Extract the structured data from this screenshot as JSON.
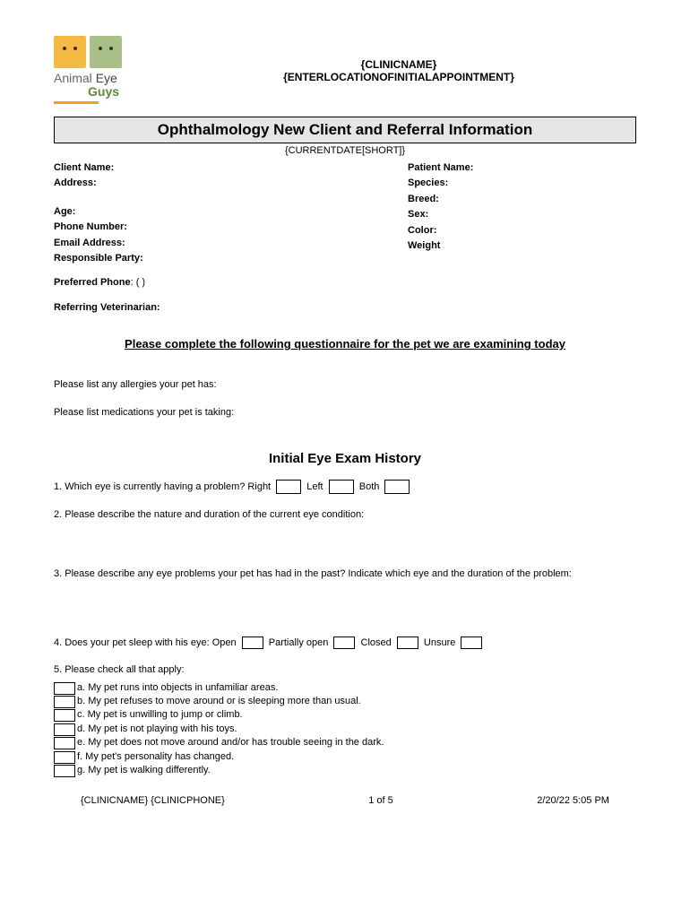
{
  "header": {
    "clinic_name_placeholder": "{CLINICNAME}",
    "location_placeholder": "{ENTERLOCATIONOFINITIALAPPOINTMENT}",
    "logo_text_1": "Animal",
    "logo_text_2": "Eye",
    "logo_text_3": "Guys"
  },
  "title": "Ophthalmology New Client and Referral Information",
  "date_placeholder": "{CURRENTDATE[SHORT]}",
  "left_fields": {
    "client_name": "Client Name:",
    "address": "Address:",
    "age": "Age:",
    "phone": "Phone Number:",
    "email": "Email Address:",
    "responsible": "Responsible Party:"
  },
  "right_fields": {
    "patient_name": "Patient Name:",
    "species": "Species:",
    "breed": "Breed:",
    "sex": "Sex:",
    "color": "Color:",
    "weight": "Weight"
  },
  "preferred_phone_label": "Preferred Phone",
  "preferred_phone_parens": ": (             )",
  "ref_vet": "Referring Veterinarian:",
  "questionnaire_title": "Please complete the following questionnaire for the pet we are examining today",
  "allergies": "Please list any allergies your pet has:",
  "medications": "Please list medications your pet is taking:",
  "history_title": "Initial Eye Exam History",
  "q1": {
    "text": "1. Which eye is currently having a problem?  Right",
    "left": "Left",
    "both": "Both"
  },
  "q2": "2. Please describe the nature and duration of the current eye condition:",
  "q3": "3. Please describe any eye problems your pet has had in the past?  Indicate which eye and the duration of the problem:",
  "q4": {
    "text": "4. Does your pet sleep with his eye: Open",
    "partial": "Partially open",
    "closed": "Closed",
    "unsure": "Unsure"
  },
  "q5": {
    "text": "5. Please check all that apply:",
    "items": [
      "a.  My pet runs into objects in unfamiliar areas.",
      "b.  My pet refuses to move around or is sleeping more than usual.",
      "c.  My pet is unwilling to jump or climb.",
      "d.  My pet is not playing with his toys.",
      "e.  My pet does not move around and/or has trouble seeing in the dark.",
      "f.  My pet's personality has changed.",
      "g.  My pet is walking differently."
    ]
  },
  "footer": {
    "left": "{CLINICNAME}  {CLINICPHONE}",
    "center": "1 of 5",
    "right": "2/20/22  5:05 PM"
  }
}
